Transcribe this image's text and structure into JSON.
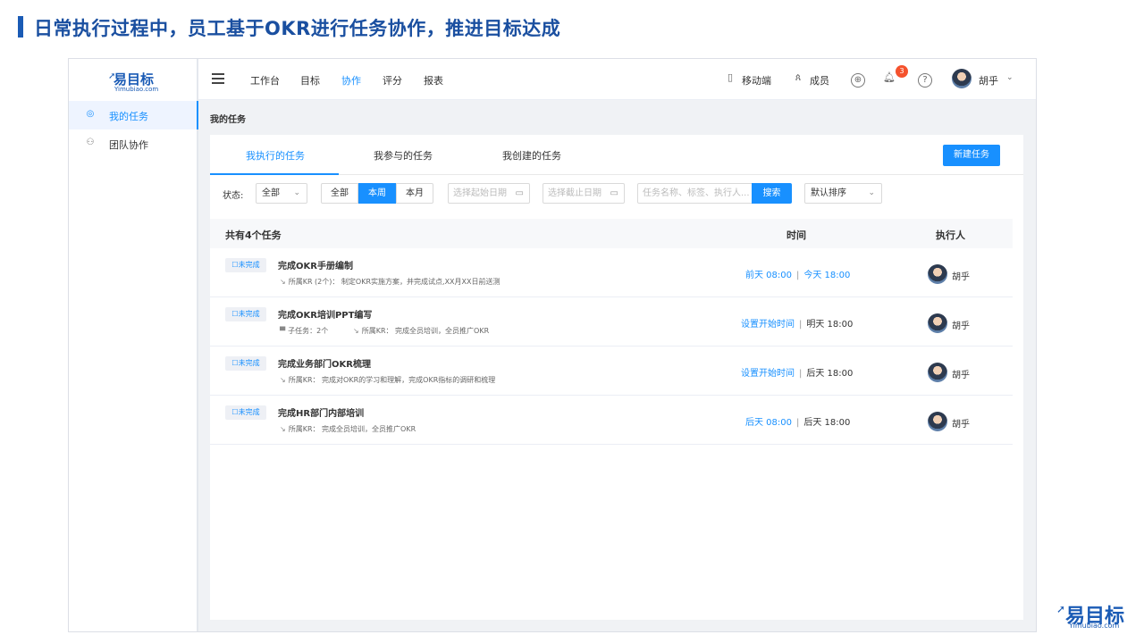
{
  "slide": {
    "title": "日常执行过程中，员工基于OKR进行任务协作，推进目标达成"
  },
  "logo": {
    "main": "易目标",
    "sub": "Yimubiao.com"
  },
  "sidebar": {
    "items": [
      {
        "label": "我的任务",
        "icon": "target-icon",
        "active": true
      },
      {
        "label": "团队协作",
        "icon": "team-icon",
        "active": false
      }
    ]
  },
  "topnav": {
    "menu_icon": "hamburger-icon",
    "items": [
      {
        "label": "工作台"
      },
      {
        "label": "目标"
      },
      {
        "label": "协作",
        "active": true
      },
      {
        "label": "评分"
      },
      {
        "label": "报表"
      }
    ],
    "mobile_label": "移动端",
    "members_label": "成员",
    "notification_count": "3",
    "help_glyph": "?",
    "user_name": "胡乎"
  },
  "breadcrumb": "我的任务",
  "tabs": [
    {
      "label": "我执行的任务",
      "active": true
    },
    {
      "label": "我参与的任务"
    },
    {
      "label": "我创建的任务"
    }
  ],
  "new_task_label": "新建任务",
  "filters": {
    "status_label": "状态:",
    "status_value": "全部",
    "range_options": [
      {
        "label": "全部"
      },
      {
        "label": "本周",
        "selected": true
      },
      {
        "label": "本月"
      }
    ],
    "start_date_placeholder": "选择起始日期",
    "end_date_placeholder": "选择截止日期",
    "search_placeholder": "任务名称、标签、执行人...",
    "search_label": "搜索",
    "sort_value": "默认排序"
  },
  "table": {
    "count_label": "共有4个任务",
    "time_header": "时间",
    "owner_header": "执行人",
    "rows": [
      {
        "status": "☐未完成",
        "title": "完成OKR手册编制",
        "meta1": "所属KR (2个)： 制定OKR实施方案，并完成试点,XX月XX日前送测",
        "meta2": "",
        "start": "前天 08:00",
        "start_unset": false,
        "end": "今天 18:00",
        "end_blue": true,
        "owner": "胡乎"
      },
      {
        "status": "☐未完成",
        "title": "完成OKR培训PPT编写",
        "subtask": "子任务：2个",
        "meta1": "",
        "meta2": "所属KR： 完成全员培训，全员推广OKR",
        "start": "设置开始时间",
        "start_unset": true,
        "end": "明天 18:00",
        "end_blue": false,
        "owner": "胡乎"
      },
      {
        "status": "☐未完成",
        "title": "完成业务部门OKR梳理",
        "meta1": "所属KR： 完成对OKR的学习和理解，完成OKR指标的调研和梳理",
        "meta2": "",
        "start": "设置开始时间",
        "start_unset": true,
        "end": "后天 18:00",
        "end_blue": false,
        "owner": "胡乎"
      },
      {
        "status": "☐未完成",
        "title": "完成HR部门内部培训",
        "meta1": "所属KR： 完成全员培训，全员推广OKR",
        "meta2": "",
        "start": "后天 08:00",
        "start_unset": false,
        "end": "后天 18:00",
        "end_blue": false,
        "owner": "胡乎"
      }
    ]
  },
  "corner_logo": {
    "main": "易目标",
    "sub": "Yimubiao.com"
  },
  "colors": {
    "accent": "#1890ff",
    "brand": "#1a5bb5",
    "badge": "#f5522d"
  }
}
